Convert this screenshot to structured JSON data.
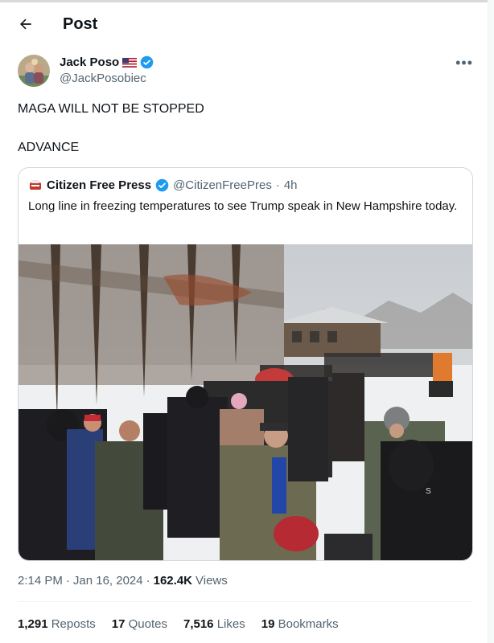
{
  "header": {
    "title": "Post"
  },
  "author": {
    "name": "Jack Poso",
    "handle": "@JackPosobiec"
  },
  "tweet": {
    "line1": "MAGA WILL NOT BE STOPPED",
    "line2": "ADVANCE"
  },
  "quote": {
    "name": "Citizen Free Press",
    "handle": "@CitizenFreePres",
    "sep": "·",
    "time": "4h",
    "text": "Long line in freezing temperatures to see Trump speak in New Hampshire today."
  },
  "meta": {
    "time": "2:14 PM",
    "sep1": "·",
    "date": "Jan 16, 2024",
    "sep2": "·",
    "views_count": "162.4K",
    "views_label": "Views"
  },
  "stats": {
    "reposts_count": "1,291",
    "reposts_label": "Reposts",
    "quotes_count": "17",
    "quotes_label": "Quotes",
    "likes_count": "7,516",
    "likes_label": "Likes",
    "bookmarks_count": "19",
    "bookmarks_label": "Bookmarks"
  },
  "colors": {
    "verified": "#1d9bf0",
    "muted": "#536471",
    "text": "#0f1419",
    "border": "#cfd9de"
  },
  "icons": {
    "back": "arrow-left-icon",
    "verified": "verified-badge-icon",
    "flag": "us-flag-icon",
    "more": "more-horizontal-icon",
    "source_logo": "citizen-free-press-logo-icon"
  }
}
